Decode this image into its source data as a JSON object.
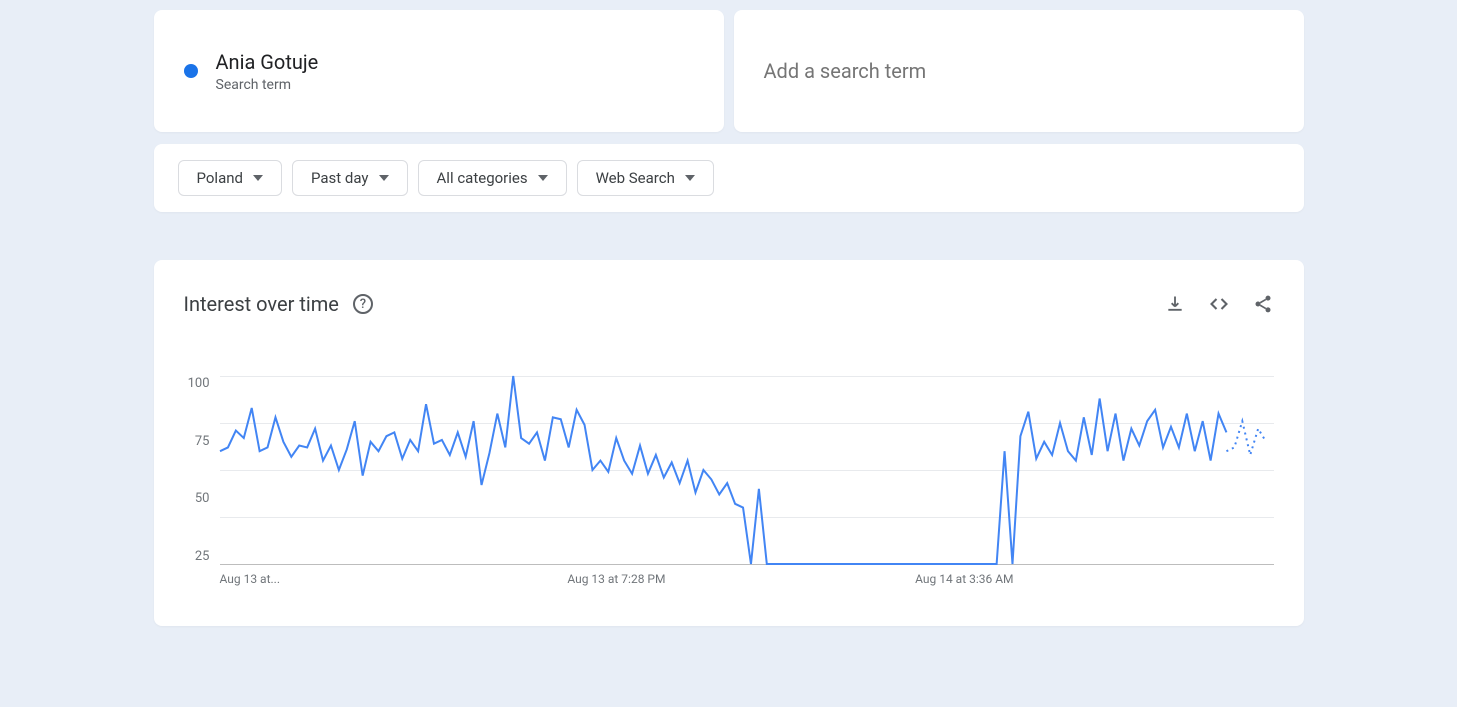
{
  "search": {
    "term": "Ania Gotuje",
    "sub": "Search term",
    "add_placeholder": "Add a search term",
    "dot_color": "#1a73e8"
  },
  "filters": {
    "region": "Poland",
    "time": "Past day",
    "category": "All categories",
    "type": "Web Search"
  },
  "chart_header": {
    "title": "Interest over time"
  },
  "chart_data": {
    "type": "line",
    "ylabel": "",
    "xlabel": "",
    "ylim": [
      0,
      100
    ],
    "y_ticks": [
      100,
      75,
      50,
      25
    ],
    "x_ticks": [
      "Aug 13 at...",
      "Aug 13 at 7:28 PM",
      "Aug 14 at 3:36 AM"
    ],
    "series": [
      {
        "name": "Ania Gotuje",
        "color": "#4285f4",
        "values": [
          60,
          62,
          71,
          67,
          83,
          60,
          62,
          78,
          65,
          57,
          63,
          62,
          72,
          55,
          63,
          50,
          61,
          76,
          47,
          65,
          60,
          68,
          70,
          56,
          66,
          60,
          85,
          64,
          66,
          58,
          70,
          57,
          76,
          42,
          59,
          80,
          62,
          100,
          67,
          64,
          70,
          55,
          78,
          77,
          62,
          82,
          74,
          50,
          55,
          49,
          67,
          55,
          48,
          63,
          48,
          58,
          46,
          54,
          43,
          55,
          38,
          50,
          45,
          37,
          43,
          32,
          30,
          0,
          40,
          0,
          0,
          0,
          0,
          0,
          0,
          0,
          0,
          0,
          0,
          0,
          0,
          0,
          0,
          0,
          0,
          0,
          0,
          0,
          0,
          0,
          0,
          0,
          0,
          0,
          0,
          0,
          0,
          0,
          0,
          60,
          0,
          68,
          81,
          56,
          65,
          58,
          75,
          60,
          55,
          78,
          58,
          88,
          60,
          80,
          55,
          72,
          63,
          76,
          82,
          62,
          73,
          62,
          80,
          60,
          76,
          55,
          80,
          70
        ],
        "dotted_tail_values": [
          60,
          62,
          76,
          58,
          72,
          65
        ]
      }
    ]
  }
}
